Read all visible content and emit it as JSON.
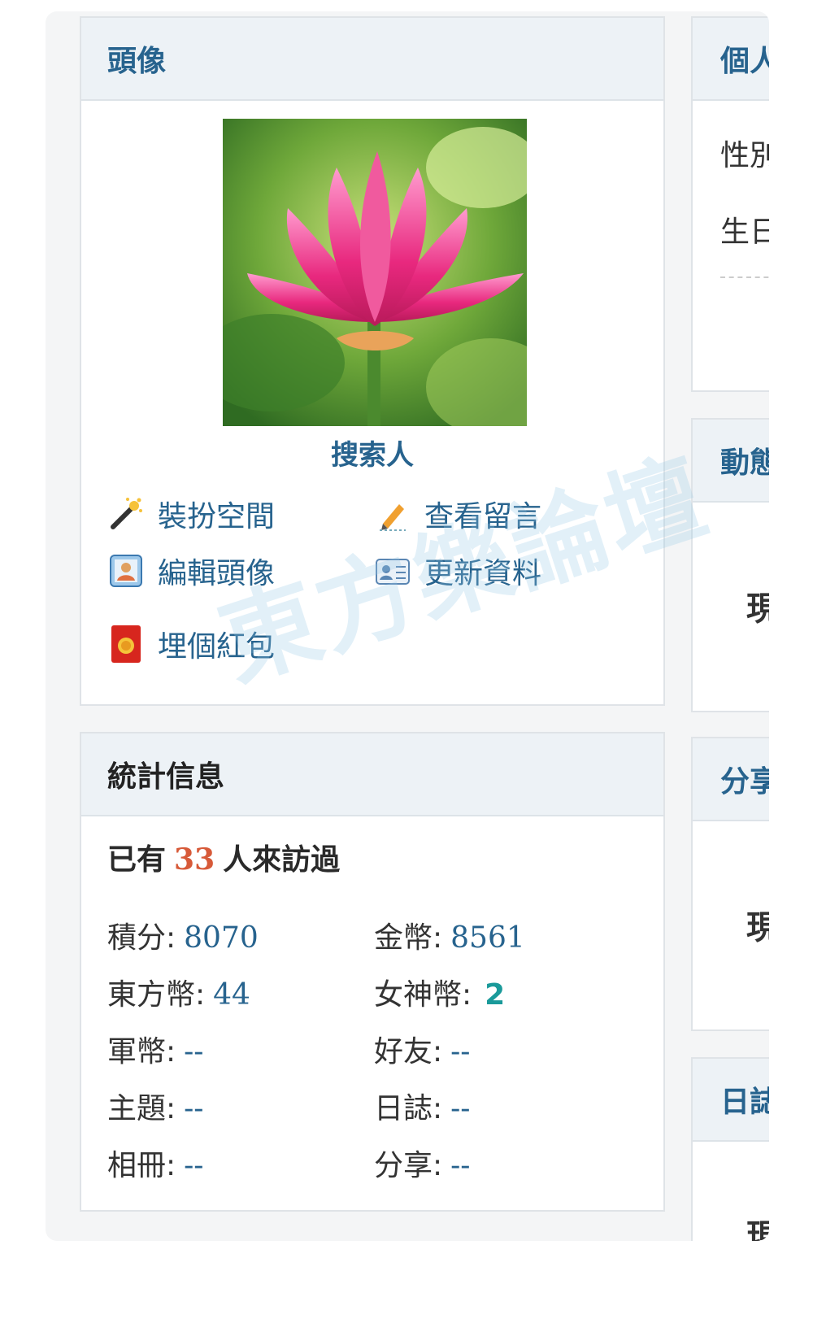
{
  "avatar_panel": {
    "title": "頭像",
    "username": "搜索人",
    "actions": [
      {
        "label": "裝扮空間",
        "icon": "magic-wand-icon"
      },
      {
        "label": "查看留言",
        "icon": "pencil-icon"
      },
      {
        "label": "編輯頭像",
        "icon": "avatar-edit-icon"
      },
      {
        "label": "更新資料",
        "icon": "profile-card-icon"
      },
      {
        "label": "埋個紅包",
        "icon": "red-envelope-icon"
      }
    ]
  },
  "stats_panel": {
    "title": "統計信息",
    "visitors": {
      "prefix": "已有",
      "count": "33",
      "suffix": "人來訪過"
    },
    "items": [
      {
        "label": "積分:",
        "value": "8070"
      },
      {
        "label": "金幣:",
        "value": "8561"
      },
      {
        "label": "東方幣:",
        "value": "44"
      },
      {
        "label": "女神幣:",
        "value": "2"
      },
      {
        "label": "軍幣:",
        "value": "--"
      },
      {
        "label": "好友:",
        "value": "--"
      },
      {
        "label": "主題:",
        "value": "--"
      },
      {
        "label": "日誌:",
        "value": "--"
      },
      {
        "label": "相冊:",
        "value": "--"
      },
      {
        "label": "分享:",
        "value": "--"
      }
    ]
  },
  "right_column": {
    "profile_title": "個人",
    "gender_label": "性別",
    "birthday_label": "生日",
    "feed_title": "動態",
    "feed_empty": "現",
    "share_title": "分享",
    "share_empty": "現",
    "blog_title": "日誌",
    "blog_empty": "現"
  },
  "watermark": "東方樂論壇",
  "colors": {
    "link": "#27638e",
    "count": "#d75a39",
    "teal": "#1a9a9a",
    "header_bg": "#edf2f6"
  }
}
